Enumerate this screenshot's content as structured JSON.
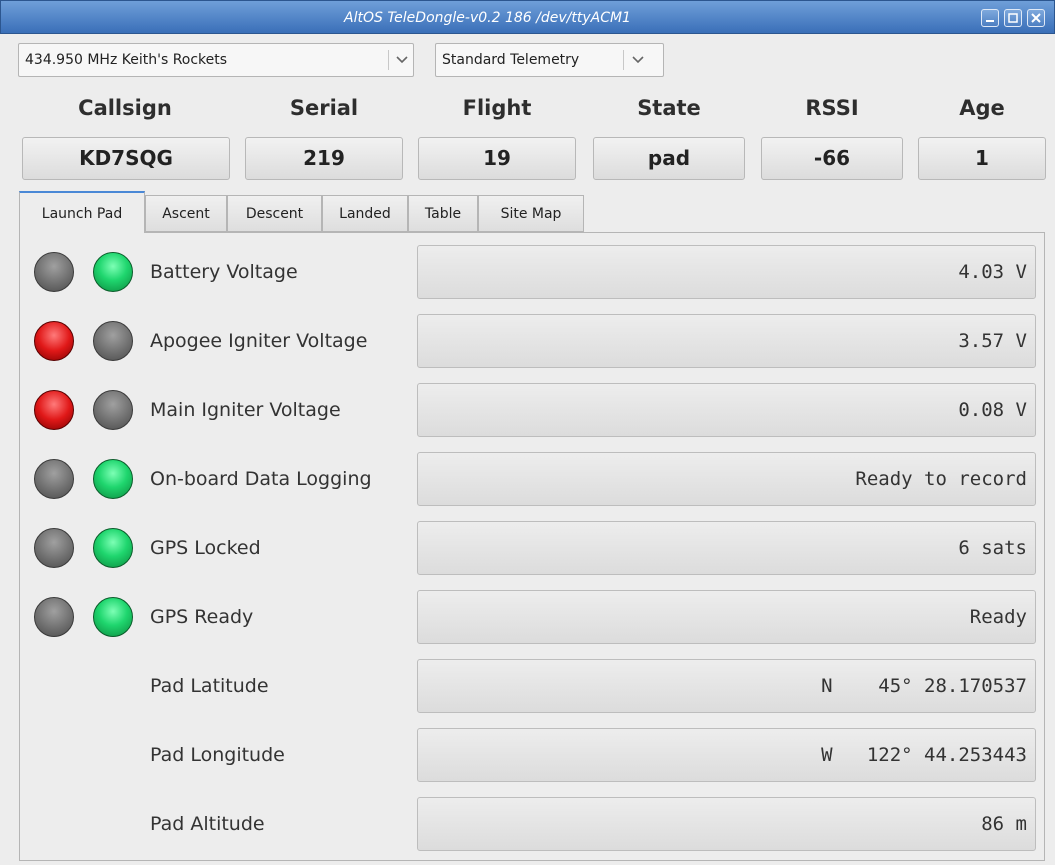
{
  "window": {
    "title": "AltOS TeleDongle-v0.2 186 /dev/ttyACM1"
  },
  "controls": {
    "frequency": "434.950 MHz Keith's Rockets",
    "telemetry": "Standard Telemetry"
  },
  "header": {
    "labels": [
      "Callsign",
      "Serial",
      "Flight",
      "State",
      "RSSI",
      "Age"
    ],
    "values": [
      "KD7SQG",
      "219",
      "19",
      "pad",
      "-66",
      "1"
    ]
  },
  "tabs": [
    "Launch Pad",
    "Ascent",
    "Descent",
    "Landed",
    "Table",
    "Site Map"
  ],
  "active_tab": "Launch Pad",
  "rows": [
    {
      "label": "Battery Voltage",
      "value": "4.03 V",
      "led_left": "gray",
      "led_right": "green"
    },
    {
      "label": "Apogee Igniter Voltage",
      "value": "3.57 V",
      "led_left": "red",
      "led_right": "gray"
    },
    {
      "label": "Main Igniter Voltage",
      "value": "0.08 V",
      "led_left": "red",
      "led_right": "gray"
    },
    {
      "label": "On-board Data Logging",
      "value": "Ready to record",
      "led_left": "gray",
      "led_right": "green"
    },
    {
      "label": "GPS Locked",
      "value": "6 sats",
      "led_left": "gray",
      "led_right": "green"
    },
    {
      "label": "GPS Ready",
      "value": "Ready",
      "led_left": "gray",
      "led_right": "green"
    },
    {
      "label": "Pad Latitude",
      "value": "N    45° 28.170537"
    },
    {
      "label": "Pad Longitude",
      "value": "W   122° 44.253443"
    },
    {
      "label": "Pad Altitude",
      "value": "86 m"
    }
  ],
  "colors": {
    "title_bar": "#3a6fb8",
    "active_tab_accent": "#4a88d6",
    "led_green": "#1fd66e",
    "led_red": "#e01818",
    "led_gray": "#707070"
  }
}
